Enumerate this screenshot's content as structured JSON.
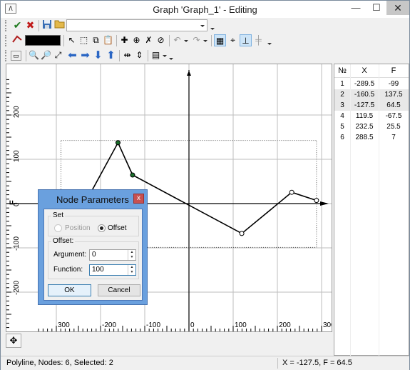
{
  "window": {
    "title": "Graph 'Graph_1' - Editing",
    "app_icon": "graph-app-icon",
    "minimize_glyph": "—",
    "maximize_glyph": "☐",
    "close_glyph": "✕"
  },
  "toolbars": {
    "row1": {
      "icons": [
        "check-icon",
        "cancel-icon",
        "save-icon",
        "open-icon"
      ],
      "combo_value": ""
    },
    "row2": {
      "color_value": "#000000",
      "icons": [
        "select-pointer-icon",
        "select-area-icon",
        "copy-icon",
        "paste-icon",
        "add-node-icon",
        "insert-node-icon",
        "delete-node-icon",
        "clear-icon",
        "undo-icon",
        "redo-icon",
        "snap-grid-icon",
        "snap-node-icon",
        "axis-snap-icon",
        "align-icon"
      ]
    },
    "row3": {
      "icons": [
        "view-icon",
        "zoom-in-icon",
        "zoom-out-icon",
        "zoom-fit-icon",
        "arrow-left-icon",
        "arrow-right-icon",
        "arrow-down-icon",
        "arrow-up-icon",
        "scale-x-icon",
        "scale-y-icon",
        "display-options-icon"
      ]
    }
  },
  "graph": {
    "xlabel": "X",
    "ylabel": "F",
    "x_ticks": [
      "300",
      "-200",
      "-100",
      "0",
      "100",
      "200",
      "300"
    ],
    "y_ticks": [
      "200",
      "100",
      "0",
      "-100",
      "-200"
    ],
    "xlim": [
      -350,
      300
    ],
    "ylim": [
      -280,
      280
    ],
    "grid": true
  },
  "chart_data": {
    "type": "line",
    "title": "",
    "xlabel": "X",
    "ylabel": "F",
    "series": [
      {
        "x": [
          -289.5,
          -160.5,
          -127.5,
          119.5,
          232.5,
          288.5
        ],
        "y": [
          -99,
          137.5,
          64.5,
          -67.5,
          25.5,
          7
        ]
      }
    ],
    "xlim": [
      -350,
      300
    ],
    "ylim": [
      -280,
      280
    ],
    "grid": true
  },
  "table": {
    "headers": [
      "№",
      "X",
      "F"
    ],
    "rows": [
      [
        "1",
        "-289.5",
        "-99"
      ],
      [
        "2",
        "-160.5",
        "137.5"
      ],
      [
        "3",
        "-127.5",
        "64.5"
      ],
      [
        "4",
        "119.5",
        "-67.5"
      ],
      [
        "5",
        "232.5",
        "25.5"
      ],
      [
        "6",
        "288.5",
        "7"
      ]
    ],
    "selected_rows": [
      1,
      2
    ]
  },
  "dialog": {
    "title": "Node Parameters",
    "close_glyph": "x",
    "set_label": "Set",
    "position_label": "Position",
    "offset_label": "Offset",
    "offset_group_label": "Offset:",
    "argument_label": "Argument:",
    "argument_value": "0",
    "function_label": "Function:",
    "function_value": "100",
    "ok_label": "OK",
    "cancel_label": "Cancel"
  },
  "status": {
    "left": "Polyline, Nodes: 6, Selected: 2",
    "right": "X = -127.5, F = 64.5"
  },
  "colors": {
    "accent": "#6aa0de",
    "selected_node": "#1a6e2a",
    "normal_node": "#ffffff",
    "line": "#000000"
  }
}
